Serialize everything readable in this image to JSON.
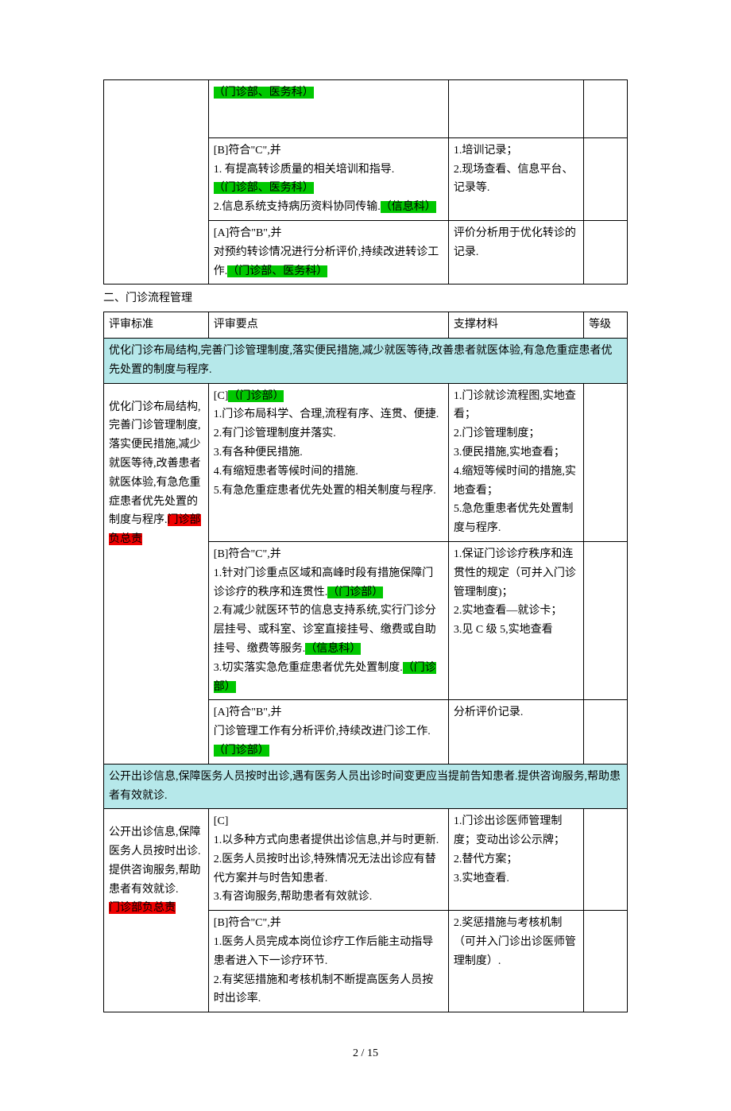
{
  "table1": {
    "r1": {
      "c2a": "（门诊部、医务科）"
    },
    "r2": {
      "c2a": "[B]符合\"C\",并",
      "c2b": "1. 有提高转诊质量的相关培训和指导.",
      "c2c": "（门诊部、医务科）",
      "c2d": "2.信息系统支持病历资料协同传输.",
      "c2e": "（信息科）",
      "c3a": "1.培训记录；",
      "c3b": "2.现场查看、信息平台、记录等."
    },
    "r3": {
      "c2a": "[A]符合\"B\",并",
      "c2b": "对预约转诊情况进行分析评价,持续改进转诊工作.",
      "c2c": "（门诊部、医务科）",
      "c3a": "评价分析用于优化转诊的记录."
    }
  },
  "section2_title": "二、门诊流程管理",
  "table2": {
    "hdr": {
      "c1": "评审标准",
      "c2": "评审要点",
      "c3": "支撑材料",
      "c4": "等级"
    },
    "sec1": "优化门诊布局结构,完善门诊管理制度,落实便民措施,减少就医等待,改善患者就医体验,有急危重症患者优先处置的制度与程序.",
    "row1": {
      "c1a": "优化门诊布局结构,完善门诊管理制度,落实便民措施,减少就医等待,改善患者就医体验,有急危重症患者优先处置的制度与程序.",
      "c1b": "门诊部负总责"
    },
    "r1a": {
      "p1a": "[C]",
      "p1b": "（门诊部）",
      "p2": "1.门诊布局科学、合理,流程有序、连贯、便捷.",
      "p3": "2.有门诊管理制度并落实.",
      "p4": "3.有各种便民措施.",
      "p5": "4.有缩短患者等候时间的措施.",
      "p6": "5.有急危重症患者优先处置的相关制度与程序.",
      "c3": "1.门诊就诊流程图,实地查看；\n2.门诊管理制度；\n3.便民措施,实地查看；\n4.缩短等候时间的措施,实地查看；\n5.急危重患者优先处置制度与程序."
    },
    "r1b": {
      "p1": "[B]符合\"C\",并",
      "p2a": "1.针对门诊重点区域和高峰时段有措施保障门诊诊疗的秩序和连贯性.",
      "p2b": "（门诊部）",
      "p3a": "2.有减少就医环节的信息支持系统,实行门诊分层挂号、或科室、诊室直接挂号、缴费或自助挂号、缴费等服务.",
      "p3b": "（信息科）",
      "p4a": "3.切实落实急危重症患者优先处置制度.",
      "p4b": "（门诊部）",
      "c3": "1.保证门诊诊疗秩序和连贯性的规定（可并入门诊管理制度)；\n2.实地查看—就诊卡；\n3.见 C 级 5,实地查看"
    },
    "r1c": {
      "p1": "[A]符合\"B\",并",
      "p2a": "门诊管理工作有分析评价,持续改进门诊工作.",
      "p2b": "（门诊部）",
      "c3": "分析评价记录."
    },
    "sec2": "公开出诊信息,保障医务人员按时出诊,遇有医务人员出诊时间变更应当提前告知患者.提供咨询服务,帮助患者有效就诊.",
    "row2": {
      "c1a": "公开出诊信息,保障医务人员按时出诊.提供咨询服务,帮助患者有效就诊.",
      "c1b": "门诊部负总责"
    },
    "r2a": {
      "p1": "[C]",
      "p2": "1.以多种方式向患者提供出诊信息,并与时更新.",
      "p3": "2.医务人员按时出诊,特殊情况无法出诊应有替代方案并与时告知患者.",
      "p4": "3.有咨询服务,帮助患者有效就诊.",
      "c3": "1.门诊出诊医师管理制度；变动出诊公示牌；\n2.替代方案；\n3.实地查看."
    },
    "r2b": {
      "p1": "[B]符合\"C\",并",
      "p2": "1.医务人员完成本岗位诊疗工作后能主动指导患者进入下一诊疗环节.",
      "p3": "2.有奖惩措施和考核机制不断提高医务人员按时出诊率.",
      "c3": "2.奖惩措施与考核机制（可并入门诊出诊医师管理制度）."
    }
  },
  "footer": {
    "page": "2",
    "sep": " / ",
    "total": "15"
  }
}
